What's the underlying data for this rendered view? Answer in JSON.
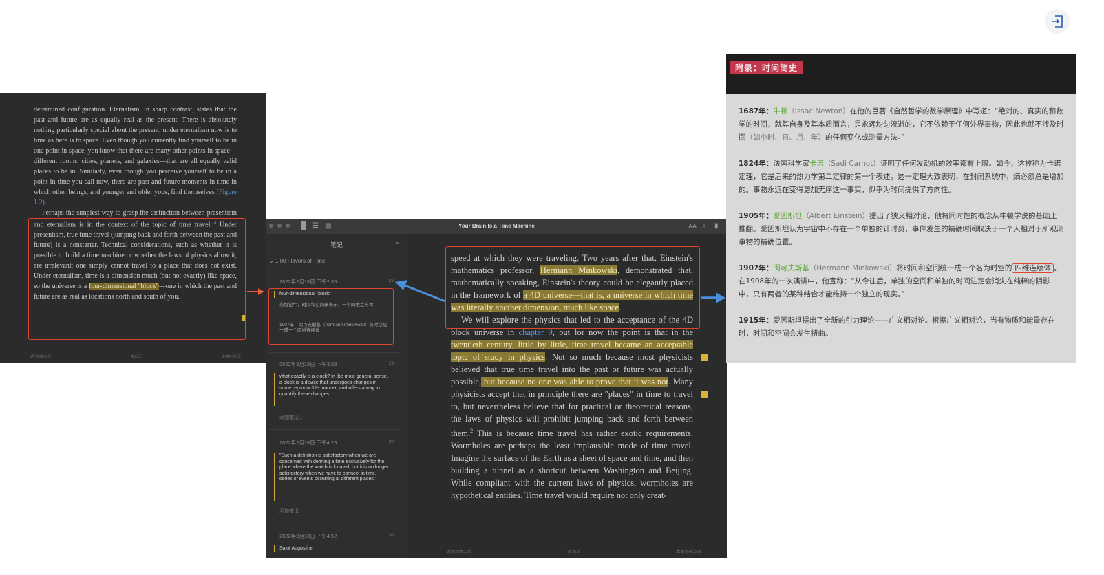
{
  "exit_icon": "exit-icon",
  "left_page": {
    "paragraph1": "determined configuration. Eternalism, in sharp contrast, states that the past and future are as equally real as the present. There is absolutely nothing particularly special about the present: under eternalism now is to time as here is to space. Even though you currently find yourself to be in one point in space, you know that there are many other points in space—different rooms, cities, planets, and galaxies—that are all equally valid places to be in. Similarly, even though you perceive yourself to be in a point in time you call now, there are past and future moments in time in which other beings, and younger and older yous, find themselves",
    "figure_link": "(Figure 1.2)",
    "paragraph2_a": "Perhaps the simplest way to grasp the distinction between presentism and eternalism is in the context of the topic of time travel.",
    "footnote": "13",
    "paragraph2_b": " Under presentism, true time travel (jumping back and forth between the past and future) is a nonstarter. Technical considerations, such as whether it is possible to build a time machine or whether the laws of physics allow it, are irrelevant; one simply cannot travel to a place that does not exist. Under eternalism, time is a dimension much (but not exactly) like space, so the universe is a ",
    "highlight": "four-dimensional \"block\"",
    "paragraph2_c": "—one in which the past and future are as real as locations north and south of you.",
    "footer": {
      "left": "返回到第20页",
      "center": "第22页",
      "right": "本章还剩5页"
    }
  },
  "reader": {
    "window_title": "Your Brain Is a Time Machine",
    "font_size_button": "AA",
    "search_icon": "search-icon",
    "bookmark_icon": "bookmark-icon",
    "sidebar": {
      "title": "笔记",
      "chapter": "1:00 Flavors of Time",
      "notes": [
        {
          "date": "2022年2月18日 下午2:39",
          "page": "22",
          "quote": "four-dimensional \"block\"",
          "note": "永恒论中，时间和空间来表示，一个四维立方体",
          "note2": "1907年，闵可夫斯基（hermann minkowski）将时空统一成一个四维连续体"
        },
        {
          "date": "2022年2月18日 下午3:29",
          "page": "29",
          "quote": "what exactly is a clock? In the most general sense, a clock is a device that undergoes changes in some reproducible manner, and offers a way to quantify these changes.",
          "add_note": "添加笔记..."
        },
        {
          "date": "2022年2月18日 下午4:29",
          "page": "29",
          "quote": "\"Such a definition is satisfactory when we are concerned with defining a time exclusively for the place where the watch is located; but it is no longer satisfactory when we have to connect in time, series of events occurring at different places.\"",
          "add_note": "添加笔记..."
        },
        {
          "date": "2022年2月18日 下午4:52",
          "page": "30",
          "quote": "Saint Augustine"
        }
      ]
    },
    "content": {
      "p1_a": "speed at which they were traveling. Two years after that, Einstein's mathematics professor, ",
      "p1_hl1": "Hermann Minkowski",
      "p1_b": ", demonstrated that, mathematically speaking, Einstein's theory could be elegantly placed in the framework of ",
      "p1_hl2": "a 4D universe—that is, a universe in which time was literally another dimension, much like space",
      "p1_c": ".",
      "p2_a": "We will explore the physics that led to the acceptance of the 4D block universe in ",
      "p2_link": "chapter 9",
      "p2_b": ", but for now the point is that in the ",
      "p2_hl1": "twentieth century, little by little, time travel became an acceptable topic of study in physics",
      "p2_c": ". Not so much because most physicists believed that true time travel into the past or future was actually possible,",
      "p2_hl2": " but because no one was able to prove that it was not",
      "p2_d": ". Many physicists accept that in principle there are \"places\" in time to travel to, but nevertheless believe that for practical or theoretical reasons, the laws of physics will prohibit jumping back and forth between them.",
      "p2_fn": "2",
      "p2_e": " This is because time travel has rather exotic requirements. Wormholes are perhaps the least implausible mode of time travel. Imagine the surface of the Earth as a sheet of space and time, and then building a tunnel as a shortcut between Washington and Beijing. While compliant with the current laws of physics, wormholes are hypothetical entities. Time travel would require not only creat-",
      "footer": {
        "left": "返回到第22页",
        "center": "第35页",
        "right": "本章还剩23页"
      }
    }
  },
  "appendix": {
    "title": "附录：时间简史",
    "entries": [
      {
        "year": "1687年：",
        "person": "牛顿",
        "en": "（Issac Newton）",
        "text_a": "在他的巨著《自然哲学的数学原理》中写道：“绝对的、真实的和数学的时间，就其自身及其本质而言，是永远均匀流逝的，它不依赖于任何外界事物，因此也就不涉及时间",
        "paren": "（如小时、日、月、年）",
        "text_b": "的任何变化或测量方法。”"
      },
      {
        "year": "1824年：",
        "prefix": "法国科学家",
        "person": "卡诺",
        "en": "（Sadi Carnot）",
        "text_a": "证明了任何发动机的效率都有上限。如今，这被称为卡诺定理，它是后来的热力学第二定律的第一个表述。这一定理大致表明，在封闭系统中，熵必须总是增加的。事物永远在变得更加无序这一事实，似乎为时间提供了方向性。"
      },
      {
        "year": "1905年：",
        "person": "爱因斯坦",
        "en": "（Albert Einstein）",
        "text_a": "提出了狭义相对论，他将同时性的概念从牛顿学说的基础上推翻。爱因斯坦认为宇宙中不存在一个单独的计时员，事件发生的精确时间取决于一个人相对于所观测事物的精确位置。"
      },
      {
        "year": "1907年：",
        "person": "闵可夫斯基",
        "en": "（Hermann Minkowski）",
        "text_a": "将时间和空间统一成一个名为时空的",
        "boxed": "四维连续体",
        "text_b": "。在1908年的一次演讲中，他宣称：“从今往后，单独的空间和单独的时间注定会消失在纯粹的阴影中，只有两者的某种结合才能维持一个独立的现实。”"
      },
      {
        "year": "1915年：",
        "text_a": "爱因斯坦提出了全新的引力理论——广义相对论。根据广义相对论，当有物质和能量存在时，时间和空间会发生扭曲。"
      }
    ]
  },
  "colors": {
    "red_box": "#e0452b",
    "arrow_orange": "#e8583a",
    "arrow_blue": "#4a8fd9",
    "highlight": "#8b7a34",
    "appendix_title_bg": "#c2374b",
    "green_name": "#59a630"
  }
}
